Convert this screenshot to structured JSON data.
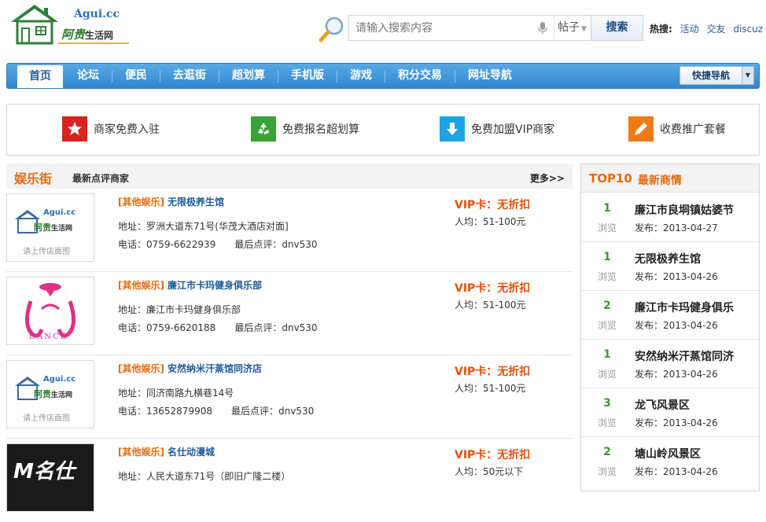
{
  "logo": {
    "en": "Agui.cc",
    "cn_main": "阿贵",
    "cn_sub": "生活网"
  },
  "search": {
    "placeholder": "请输入搜索内容",
    "type": "帖子",
    "button": "搜索"
  },
  "hot": {
    "label": "热搜:",
    "links": [
      "活动",
      "交友",
      "discuz"
    ]
  },
  "nav": {
    "items": [
      "首页",
      "论坛",
      "便民",
      "去逛街",
      "超划算",
      "手机版",
      "游戏",
      "积分交易",
      "网址导航"
    ],
    "active": 0,
    "quick": "快捷导航"
  },
  "promo": [
    {
      "label": "商家免费入驻",
      "icon": "star-icon",
      "color": "#d8231e"
    },
    {
      "label": "免费报名超划算",
      "icon": "recycle-icon",
      "color": "#3aa338"
    },
    {
      "label": "免费加盟VIP商家",
      "icon": "download-arrow-icon",
      "color": "#1ea3e6"
    },
    {
      "label": "收费推广套餐",
      "icon": "pencil-icon",
      "color": "#f07a1a"
    }
  ],
  "main": {
    "title": "娱乐街",
    "subtitle": "最新点评商家",
    "more": "更多>>",
    "rows": [
      {
        "cat": "[其他娱乐]",
        "name": "无限极养生馆",
        "addr": "地址：罗洲大道东71号(华茂大酒店对面]",
        "tel": "电话：0759-6622939",
        "last": "最后点评：dnv530",
        "vip": "VIP卡：无折扣",
        "avg": "人均：51-100元",
        "thumb": "logo"
      },
      {
        "cat": "[其他娱乐]",
        "name": "廉江市卡玛健身俱乐部",
        "addr": "地址：廉江市卡玛健身俱乐部",
        "tel": "电话：0759-6620188",
        "last": "最后点评：dnv530",
        "vip": "VIP卡：无折扣",
        "avg": "人均：51-100元",
        "thumb": "kama"
      },
      {
        "cat": "[其他娱乐]",
        "name": "安然纳米汗蒸馆同济店",
        "addr": "地址：同济南路九横巷14号",
        "tel": "电话：13652879908",
        "last": "最后点评：dnv530",
        "vip": "VIP卡：无折扣",
        "avg": "人均：51-100元",
        "thumb": "logo"
      },
      {
        "cat": "[其他娱乐]",
        "name": "名仕动漫城",
        "addr": "地址：人民大道东71号（即旧广隆二楼）",
        "tel": "",
        "last": "",
        "vip": "VIP卡：无折扣",
        "avg": "人均：50元以下",
        "thumb": "mingshi"
      }
    ],
    "thumb_placeholder": "请上传店面图",
    "kama_text": "DANCE",
    "mingshi_text": "M名仕"
  },
  "side": {
    "title1": "TOP10",
    "title2": "最新商情",
    "views_label": "浏览",
    "items": [
      {
        "count": "1",
        "name": "廉江市良垌镇姑婆节",
        "date": "发布：2013-04-27"
      },
      {
        "count": "1",
        "name": "无限极养生馆",
        "date": "发布：2013-04-26"
      },
      {
        "count": "2",
        "name": "廉江市卡玛健身俱乐",
        "date": "发布：2013-04-26"
      },
      {
        "count": "1",
        "name": "安然纳米汗蒸馆同济",
        "date": "发布：2013-04-26"
      },
      {
        "count": "3",
        "name": "龙飞风景区",
        "date": "发布：2013-04-26"
      },
      {
        "count": "2",
        "name": "塘山岭风景区",
        "date": "发布：2013-04-26"
      }
    ]
  }
}
